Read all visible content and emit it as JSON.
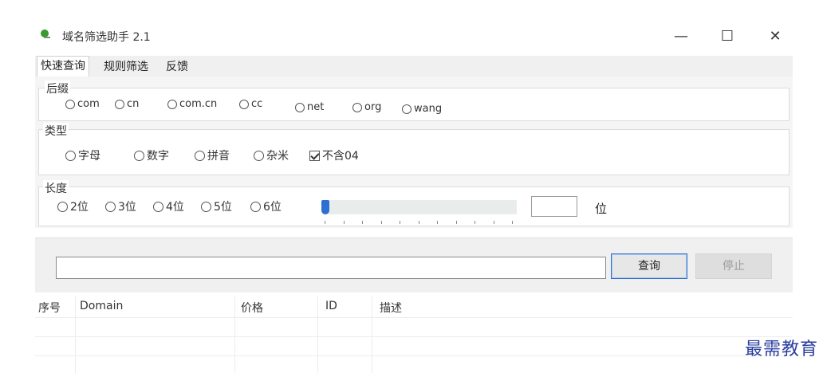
{
  "window": {
    "title": "域名筛选助手 2.1",
    "icon": "app-leaf-icon",
    "controls": {
      "minimize": "—",
      "maximize": "☐",
      "close": "✕"
    }
  },
  "tabs": [
    {
      "label": "快速查询",
      "active": true
    },
    {
      "label": "规则筛选",
      "active": false
    },
    {
      "label": "反馈",
      "active": false
    }
  ],
  "suffix": {
    "label": "后缀",
    "options": [
      "com",
      "cn",
      "com.cn",
      "cc",
      "net",
      "org",
      "wang"
    ]
  },
  "type": {
    "label": "类型",
    "options": [
      "字母",
      "数字",
      "拼音",
      "杂米"
    ],
    "exclude04": {
      "label": "不含04",
      "checked": true
    }
  },
  "length": {
    "label": "长度",
    "options": [
      "2位",
      "3位",
      "4位",
      "5位",
      "6位"
    ],
    "slider_value": 0,
    "custom_value": "",
    "unit": "位"
  },
  "query": {
    "input_value": "",
    "search_label": "查询",
    "stop_label": "停止"
  },
  "table": {
    "columns": [
      "序号",
      "Domain",
      "价格",
      "ID",
      "描述"
    ],
    "rows": []
  },
  "watermark": "最需教育",
  "colors": {
    "accent": "#2e6fd2",
    "watermark": "#2a3f9e"
  }
}
